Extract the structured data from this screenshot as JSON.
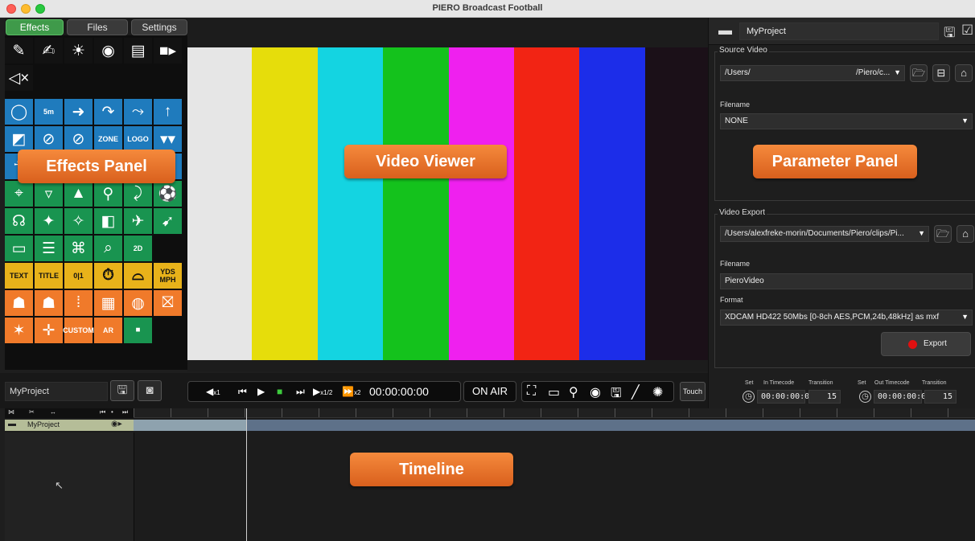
{
  "window": {
    "title": "PIERO Broadcast Football"
  },
  "left_panel": {
    "tabs": [
      {
        "label": "Effects",
        "active": true
      },
      {
        "label": "Files",
        "active": false
      },
      {
        "label": "Settings",
        "active": false
      }
    ],
    "grid_texts": {
      "zone": "ZONE",
      "logo": "LOGO",
      "text": "TEXT",
      "title": "TITLE",
      "counter": "0|1",
      "yds": "YDS",
      "mph": "MPH",
      "custom": "CUSTOM",
      "ar": "AR",
      "twod": "2D",
      "fivem": "5m"
    }
  },
  "viewer": {
    "color_bars": [
      "#e6e6e6",
      "#e6dd0b",
      "#14d4e1",
      "#14c21c",
      "#ef20ef",
      "#f22414",
      "#1c2de9",
      "#1b1018"
    ]
  },
  "transport": {
    "project_name": "MyProject",
    "timecode": "00:00:00:00",
    "onair_label": "ON AIR",
    "touch_label": "Touch",
    "speed_back": "x1",
    "speed_half": "x1/2",
    "speed_double": "x2"
  },
  "parameter_panel": {
    "project_name": "MyProject",
    "source_video": {
      "title": "Source Video",
      "path_left": "/Users/",
      "path_right": "/Piero/c...",
      "filename_label": "Filename",
      "filename_value": "NONE"
    },
    "video_export": {
      "title": "Video Export",
      "path": "/Users/alexfreke-morin/Documents/Piero/clips/Pi...",
      "filename_label": "Filename",
      "filename_value": "PieroVideo",
      "format_label": "Format",
      "format_value": "XDCAM HD422 50Mbs [0-8ch AES,PCM,24b,48kHz] as mxf",
      "export_label": "Export"
    },
    "in_point": {
      "set_label": "Set",
      "timecode_label": "In Timecode",
      "transition_label": "Transition",
      "timecode": "00:00:00:00",
      "transition": "15"
    },
    "out_point": {
      "set_label": "Set",
      "timecode_label": "Out Timecode",
      "transition_label": "Transition",
      "timecode": "00:00:00:00",
      "transition": "15"
    }
  },
  "timeline": {
    "track_name": "MyProject"
  },
  "callouts": {
    "effects": "Effects Panel",
    "viewer": "Video Viewer",
    "parameter": "Parameter Panel",
    "timeline": "Timeline"
  },
  "colors": {
    "accent_green": "#3f9a4a",
    "callout_orange": "#e8742d",
    "record_red": "#e01010"
  }
}
